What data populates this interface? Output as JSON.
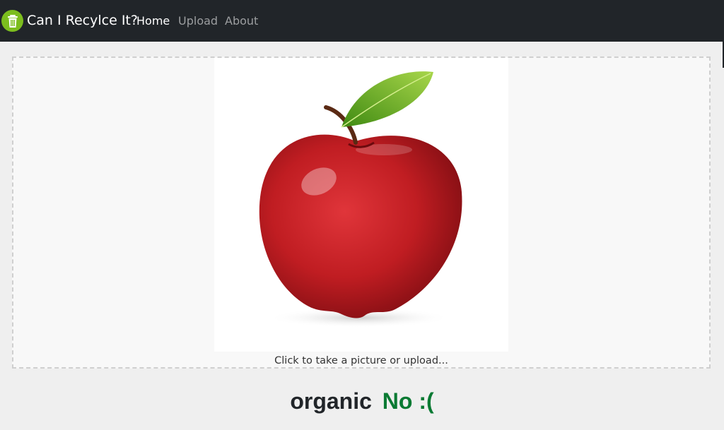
{
  "app": {
    "brand": "Can I Recylce It?",
    "logo_icon": "trash-can-icon",
    "logo_color": "#7cbd1e"
  },
  "nav": {
    "items": [
      {
        "label": "Home",
        "active": true
      },
      {
        "label": "Upload",
        "active": false
      },
      {
        "label": "About",
        "active": false
      }
    ]
  },
  "upload": {
    "caption": "Click to take a picture or upload...",
    "image_subject": "red-apple-photo"
  },
  "result": {
    "category": "organic",
    "verdict": "No :(",
    "verdict_color": "#0a7a33"
  }
}
